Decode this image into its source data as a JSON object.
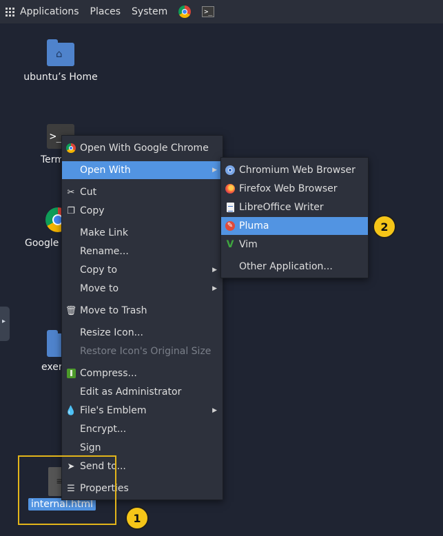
{
  "panel": {
    "applications": "Applications",
    "places": "Places",
    "system": "System"
  },
  "desktop": {
    "home_label": "ubuntu’s Home",
    "terminal_label": "Term",
    "chrome_label": "Google C",
    "folder_label": "exer",
    "file_label": "internal.html"
  },
  "context_menu": {
    "items": [
      {
        "label": "Open With Google Chrome",
        "icon": "chrome-icon"
      },
      {
        "label": "Open With",
        "icon": "",
        "submenu": true
      },
      {
        "label": "Cut",
        "icon": "scissors-icon"
      },
      {
        "label": "Copy",
        "icon": "copy-icon"
      },
      {
        "label": "Make Link",
        "icon": ""
      },
      {
        "label": "Rename...",
        "icon": ""
      },
      {
        "label": "Copy to",
        "icon": "",
        "submenu": true
      },
      {
        "label": "Move to",
        "icon": "",
        "submenu": true
      },
      {
        "label": "Move to Trash",
        "icon": "trash-icon"
      },
      {
        "label": "Resize Icon...",
        "icon": ""
      },
      {
        "label": "Restore Icon's Original Size",
        "icon": "",
        "disabled": true
      },
      {
        "label": "Compress...",
        "icon": "archive-icon"
      },
      {
        "label": "Edit as Administrator",
        "icon": ""
      },
      {
        "label": "File's Emblem",
        "icon": "drop-icon",
        "submenu": true
      },
      {
        "label": "Encrypt...",
        "icon": ""
      },
      {
        "label": "Sign",
        "icon": ""
      },
      {
        "label": "Send to...",
        "icon": "send-icon"
      },
      {
        "label": "Properties",
        "icon": "properties-icon"
      }
    ]
  },
  "open_with_submenu": {
    "items": [
      {
        "label": "Chromium Web Browser",
        "icon": "chromium-icon"
      },
      {
        "label": "Firefox Web Browser",
        "icon": "firefox-icon"
      },
      {
        "label": "LibreOffice Writer",
        "icon": "writer-icon"
      },
      {
        "label": "Pluma",
        "icon": "pluma-icon",
        "selected": true
      },
      {
        "label": "Vim",
        "icon": "vim-icon"
      },
      {
        "label": "Other Application...",
        "icon": ""
      }
    ]
  },
  "annotations": {
    "badge1": "1",
    "badge2": "2"
  },
  "colors": {
    "desktop_bg": "#1f2432",
    "menu_bg": "#2d313c",
    "selection": "#5294e2",
    "annotation": "#f5c518"
  }
}
